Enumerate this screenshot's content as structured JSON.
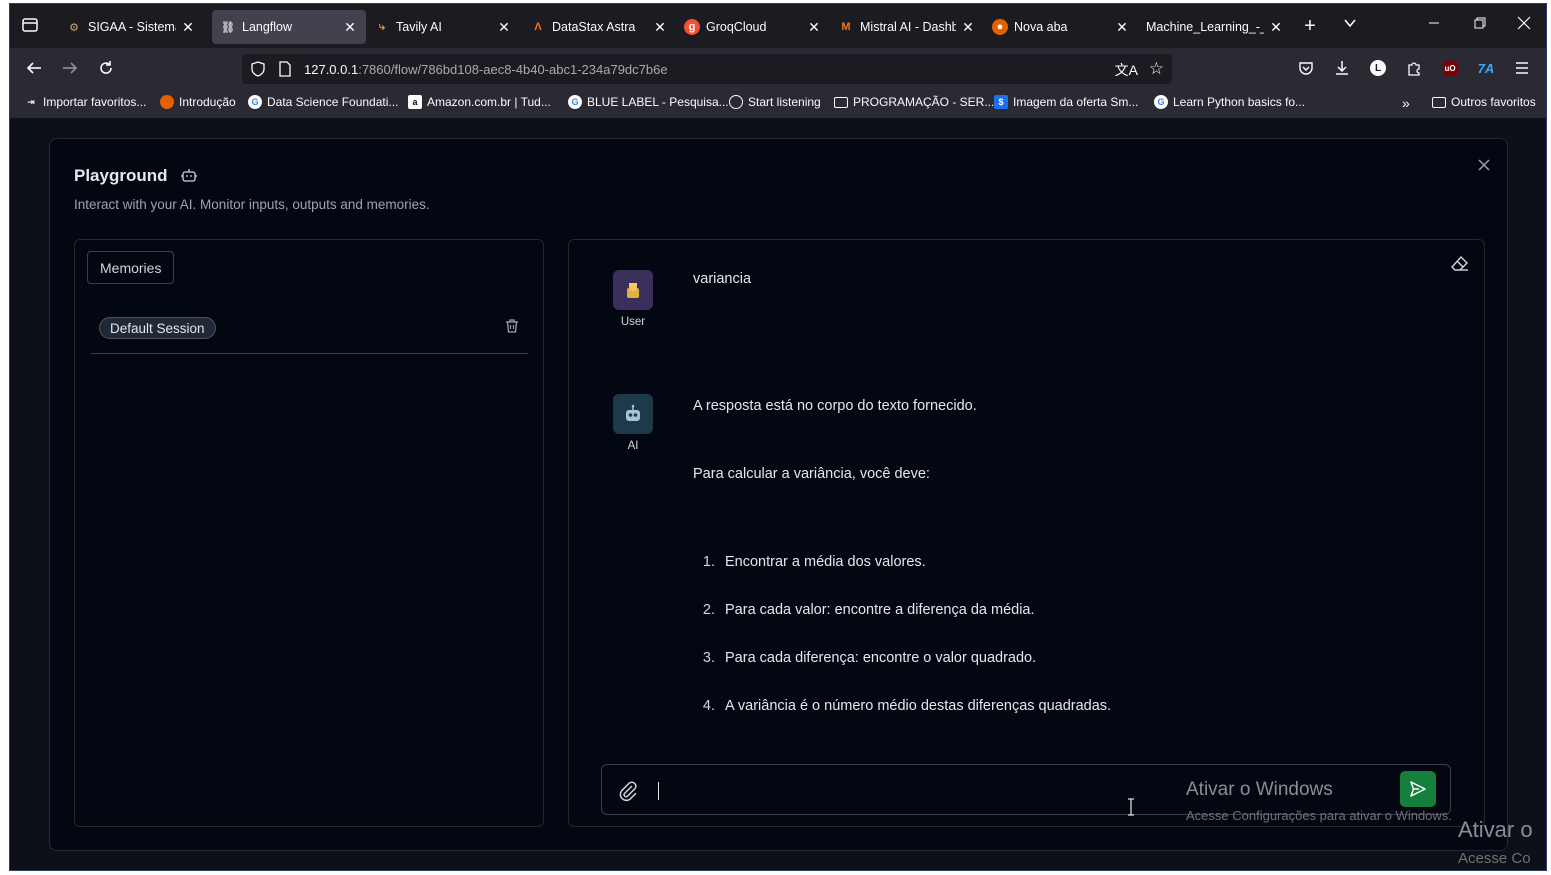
{
  "browser": {
    "tabs": [
      {
        "label": "SIGAA - Sistema In",
        "icon": "sigaa-icon",
        "active": false
      },
      {
        "label": "Langflow",
        "icon": "langflow-icon",
        "active": true
      },
      {
        "label": "Tavily AI",
        "icon": "tavily-icon",
        "active": false
      },
      {
        "label": "DataStax Astra",
        "icon": "datastax-icon",
        "active": false
      },
      {
        "label": "GroqCloud",
        "icon": "groq-icon",
        "active": false
      },
      {
        "label": "Mistral AI - Dashb",
        "icon": "mistral-icon",
        "active": false
      },
      {
        "label": "Nova aba",
        "icon": "firefox-icon",
        "active": false
      },
      {
        "label": "Machine_Learning_-_P",
        "icon": "",
        "active": false
      }
    ],
    "url": {
      "host": "127.0.0.1",
      "path": ":7860/flow/786bd108-aec8-4b40-abc1-234a79dc7b6e"
    },
    "bookmarks": [
      {
        "label": "Importar favoritos...",
        "icon": "import-icon"
      },
      {
        "label": "Introdução",
        "icon": "firefox-icon"
      },
      {
        "label": "Data Science Foundati...",
        "icon": "google-icon"
      },
      {
        "label": "Amazon.com.br | Tud...",
        "icon": "amazon-icon"
      },
      {
        "label": "BLUE LABEL - Pesquisa...",
        "icon": "google-icon"
      },
      {
        "label": "Start listening",
        "icon": "globe-icon"
      },
      {
        "label": "PROGRAMAÇÃO - SER...",
        "icon": "folder-icon"
      },
      {
        "label": "Imagem da oferta Sm...",
        "icon": "dollar-icon"
      },
      {
        "label": "Learn Python basics fo...",
        "icon": "google-icon"
      }
    ],
    "other_bookmarks": "Outros favoritos"
  },
  "playground": {
    "title": "Playground",
    "subtitle": "Interact with your AI. Monitor inputs, outputs and memories.",
    "memories_label": "Memories",
    "session_label": "Default Session",
    "messages": {
      "user": {
        "sender": "User",
        "text": "variancia"
      },
      "ai": {
        "sender": "AI",
        "intro": "A resposta está no corpo do texto fornecido.",
        "lead": "Para calcular a variância, você deve:",
        "steps": [
          {
            "n": "1.",
            "text": "Encontrar a média dos valores."
          },
          {
            "n": "2.",
            "text": "Para cada valor: encontre a diferença da média."
          },
          {
            "n": "3.",
            "text": "Para cada diferença: encontre o valor quadrado."
          },
          {
            "n": "4.",
            "text": "A variância é o número médio destas diferenças quadradas."
          }
        ]
      }
    },
    "input_value": ""
  },
  "overlay": {
    "activate_title": "Ativar o Windows",
    "activate_sub": "Acesse Configurações para ativar o Windows.",
    "activate_title_2": "Ativar o",
    "activate_sub_2": "Acesse Co"
  },
  "colors": {
    "send_button": "#15803d",
    "user_avatar": "#3b2f5c",
    "ai_avatar": "#1e3a4a"
  }
}
